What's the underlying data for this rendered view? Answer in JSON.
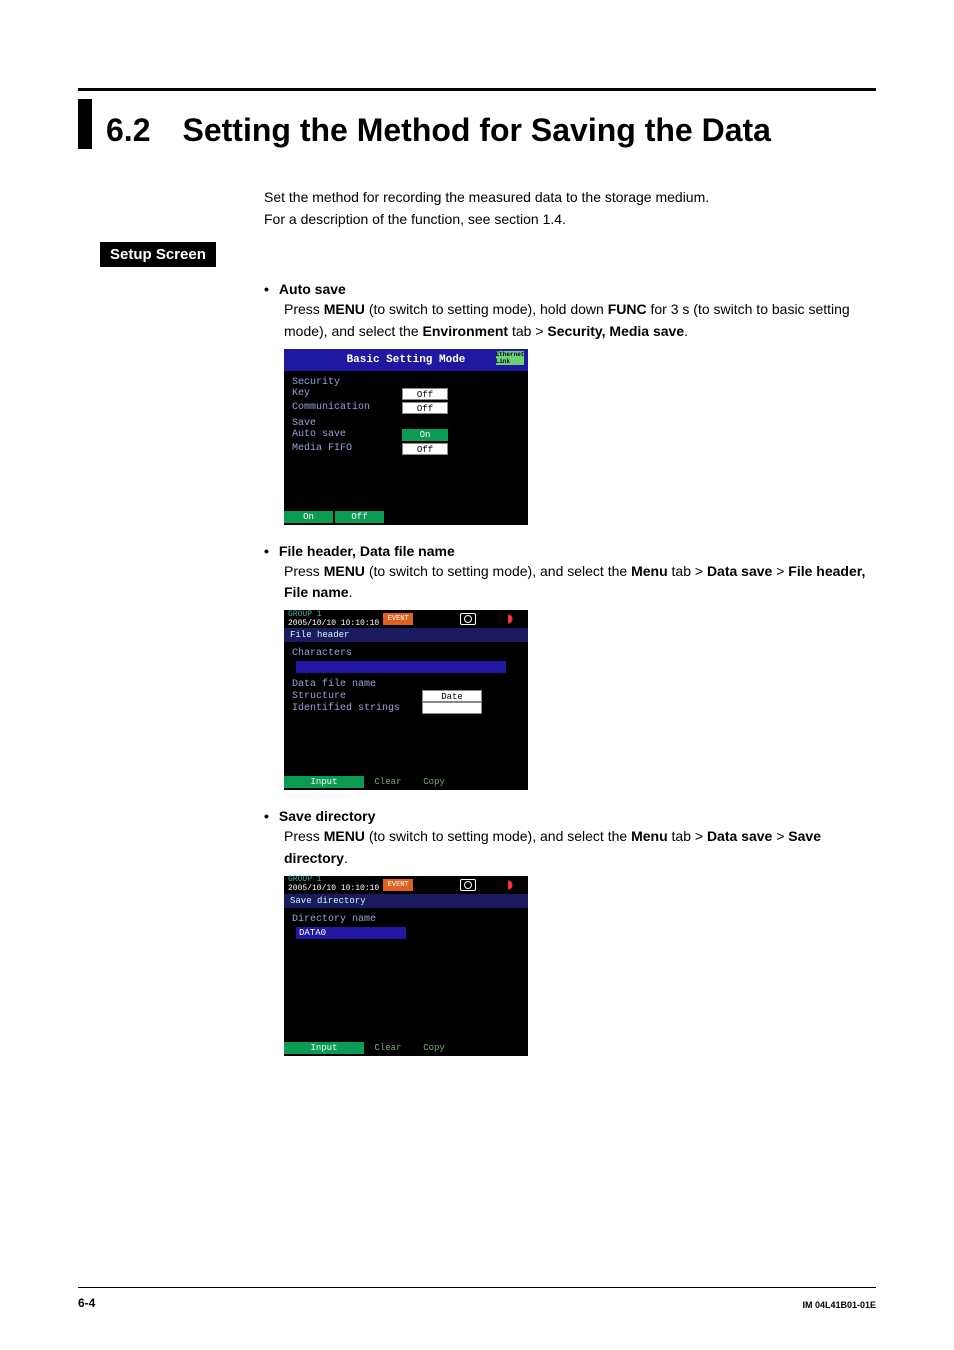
{
  "title": {
    "number": "6.2",
    "text": "Setting the Method for Saving the Data"
  },
  "intro": {
    "line1": "Set the method for recording the measured data to the storage medium.",
    "line2": "For a description of the function, see section 1.4."
  },
  "setup_label": "Setup Screen",
  "sections": [
    {
      "heading": "Auto save",
      "body": {
        "p1": "Press ",
        "b1": "MENU",
        "p2": " (to switch to setting mode), hold down ",
        "b2": "FUNC",
        "p3": " for 3 s (to switch to basic setting mode), and select the ",
        "b3": "Environment",
        "p4": " tab > ",
        "b4": "Security, Media save",
        "p5": "."
      }
    },
    {
      "heading": "File header, Data file name",
      "body": {
        "p1": "Press ",
        "b1": "MENU",
        "p2": " (to switch to setting mode), and select the ",
        "b2": "Menu",
        "p3": " tab > ",
        "b3": "Data save",
        "p4": " > ",
        "b4": "File header, File name",
        "p5": "."
      }
    },
    {
      "heading": "Save directory",
      "body": {
        "p1": "Press ",
        "b1": "MENU",
        "p2": " (to switch to setting mode), and select the ",
        "b2": "Menu",
        "p3": " tab > ",
        "b3": "Data save",
        "p4": " > ",
        "b4": "Save directory",
        "p5": "."
      }
    }
  ],
  "shots": {
    "basic": {
      "title": "Basic Setting Mode",
      "eth": "Ethernet Link",
      "sec1": "Security",
      "sec2": "Save",
      "rows": [
        {
          "label": " Key",
          "value": "Off"
        },
        {
          "label": " Communication",
          "value": "Off"
        },
        {
          "label": " Auto save",
          "value": "On"
        },
        {
          "label": " Media FIFO",
          "value": "Off"
        }
      ],
      "soft": [
        "On",
        "Off"
      ]
    },
    "file": {
      "group": "GROUP 1",
      "timestamp": "2005/10/10 10:10:10",
      "badge": "EVENT",
      "tab1": "File header",
      "lbl_chars": " Characters",
      "lbl_dfn": "Data file name",
      "lbl_struct": " Structure",
      "val_struct": "Date",
      "lbl_id": " Identified strings",
      "soft": [
        "Input",
        "Clear",
        "Copy"
      ]
    },
    "dir": {
      "group": "GROUP 1",
      "timestamp": "2005/10/10 10:10:10",
      "badge": "EVENT",
      "tab1": "Save directory",
      "lbl_dirname": " Directory name",
      "val_dirname": "DATA0",
      "soft": [
        "Input",
        "Clear",
        "Copy"
      ]
    }
  },
  "footer": {
    "page": "6-4",
    "docid": "IM 04L41B01-01E"
  }
}
